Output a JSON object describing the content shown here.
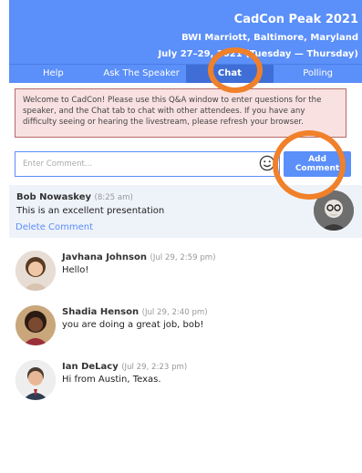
{
  "header": {
    "title": "CadCon Peak 2021",
    "venue": "BWI Marriott, Baltimore, Maryland",
    "dates": "July 27–29, 2021 (Tuesday — Thursday)"
  },
  "tabs": [
    {
      "label": "Help"
    },
    {
      "label": "Ask The Speaker"
    },
    {
      "label": "Chat"
    },
    {
      "label": "Polling"
    }
  ],
  "welcome_text": "Welcome to CadCon! Please use this Q&A window to enter questions for the speaker, and the Chat tab to chat with other attendees. If you have any difficulty seeing or hearing the livestream, please refresh your browser.",
  "composer": {
    "placeholder": "Enter Comment...",
    "add_label": "Add Comment",
    "emoji_icon": "smiley-icon"
  },
  "own_comment": {
    "author": "Bob Nowaskey",
    "time": "(8:25 am)",
    "text": "This is an excellent presentation",
    "delete_label": "Delete Comment"
  },
  "comments": [
    {
      "author": "Javhana Johnson",
      "time": "(Jul 29, 2:59 pm)",
      "text": "Hello!"
    },
    {
      "author": "Shadia Henson",
      "time": "(Jul 29, 2:40 pm)",
      "text": "you are doing a great job, bob!"
    },
    {
      "author": "Ian DeLacy",
      "time": "(Jul 29, 2:23 pm)",
      "text": "Hi from Austin, Texas."
    }
  ],
  "colors": {
    "accent": "#5b8ff9",
    "active_tab": "#3f6fd6",
    "notice_bg": "#f8e1e0",
    "notice_border": "#b76a68",
    "annotation": "#f0802a"
  }
}
